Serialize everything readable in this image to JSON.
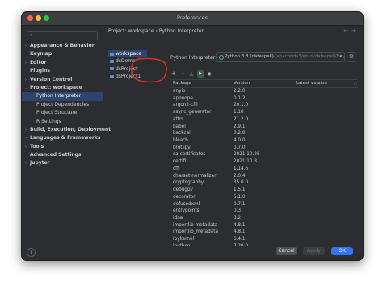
{
  "window": {
    "title": "Preferences"
  },
  "sidebar": {
    "items": [
      {
        "label": "Appearance & Behavior",
        "chevron": "›"
      },
      {
        "label": "Keymap",
        "chevron": ""
      },
      {
        "label": "Editor",
        "chevron": "›"
      },
      {
        "label": "Plugins",
        "chevron": ""
      },
      {
        "label": "Version Control",
        "chevron": "›"
      },
      {
        "label": "Project: workspace",
        "chevron": "⌄"
      },
      {
        "label": "Python Interpreter",
        "chevron": ""
      },
      {
        "label": "Project Dependencies",
        "chevron": ""
      },
      {
        "label": "Project Structure",
        "chevron": ""
      },
      {
        "label": "R Settings",
        "chevron": ""
      },
      {
        "label": "Build, Execution, Deployment",
        "chevron": "›"
      },
      {
        "label": "Languages & Frameworks",
        "chevron": "›"
      },
      {
        "label": "Tools",
        "chevron": "›"
      },
      {
        "label": "Advanced Settings",
        "chevron": ""
      },
      {
        "label": "Jupyter",
        "chevron": "›"
      }
    ]
  },
  "breadcrumb": {
    "project": "Project: workspace",
    "separator": "›",
    "page": "Python Interpreter"
  },
  "projects": [
    "workspace",
    "dsDemo",
    "dsProject",
    "dsProject1"
  ],
  "interpreter": {
    "label": "Python Interpreter:",
    "selected": "Python 3.8 (dataspell)",
    "path": "~/anaconda3/envs/dataspell/bin/py"
  },
  "toolbar": {
    "add": "+",
    "remove": "−",
    "up": "▲",
    "eye": "◉"
  },
  "table": {
    "headers": [
      "Package",
      "Version",
      "Latest version"
    ],
    "rows": [
      [
        "anyio",
        "2.2.0"
      ],
      [
        "appnope",
        "0.1.2"
      ],
      [
        "argon2-cffi",
        "20.1.0"
      ],
      [
        "async_generator",
        "1.10"
      ],
      [
        "attrs",
        "21.2.0"
      ],
      [
        "babel",
        "2.9.1"
      ],
      [
        "backcall",
        "0.2.0"
      ],
      [
        "bleach",
        "4.0.0"
      ],
      [
        "brotlipy",
        "0.7.0"
      ],
      [
        "ca-certificates",
        "2021.10.26"
      ],
      [
        "certifi",
        "2021.10.8"
      ],
      [
        "cffi",
        "1.14.6"
      ],
      [
        "charset-normalizer",
        "2.0.4"
      ],
      [
        "cryptography",
        "35.0.0"
      ],
      [
        "debugpy",
        "1.5.1"
      ],
      [
        "decorator",
        "5.1.0"
      ],
      [
        "defusedxml",
        "0.7.1"
      ],
      [
        "entrypoints",
        "0.3"
      ],
      [
        "idna",
        "3.2"
      ],
      [
        "importlib-metadata",
        "4.8.1"
      ],
      [
        "importlib_metadata",
        "4.8.1"
      ],
      [
        "ipykernel",
        "6.4.1"
      ],
      [
        "ipython",
        "7.29.0"
      ],
      [
        "ipython_genutils",
        "0.2.0"
      ]
    ]
  },
  "footer": {
    "help": "?",
    "cancel": "Cancel",
    "apply": "Apply",
    "ok": "OK"
  },
  "colors": {
    "accent": "#3574f0",
    "selection": "#2e436e",
    "annotation": "#e0301e",
    "background": "#2b2d30"
  },
  "icons": [
    "search-icon",
    "folder-icon",
    "python-icon",
    "gear-icon",
    "help-icon"
  ]
}
